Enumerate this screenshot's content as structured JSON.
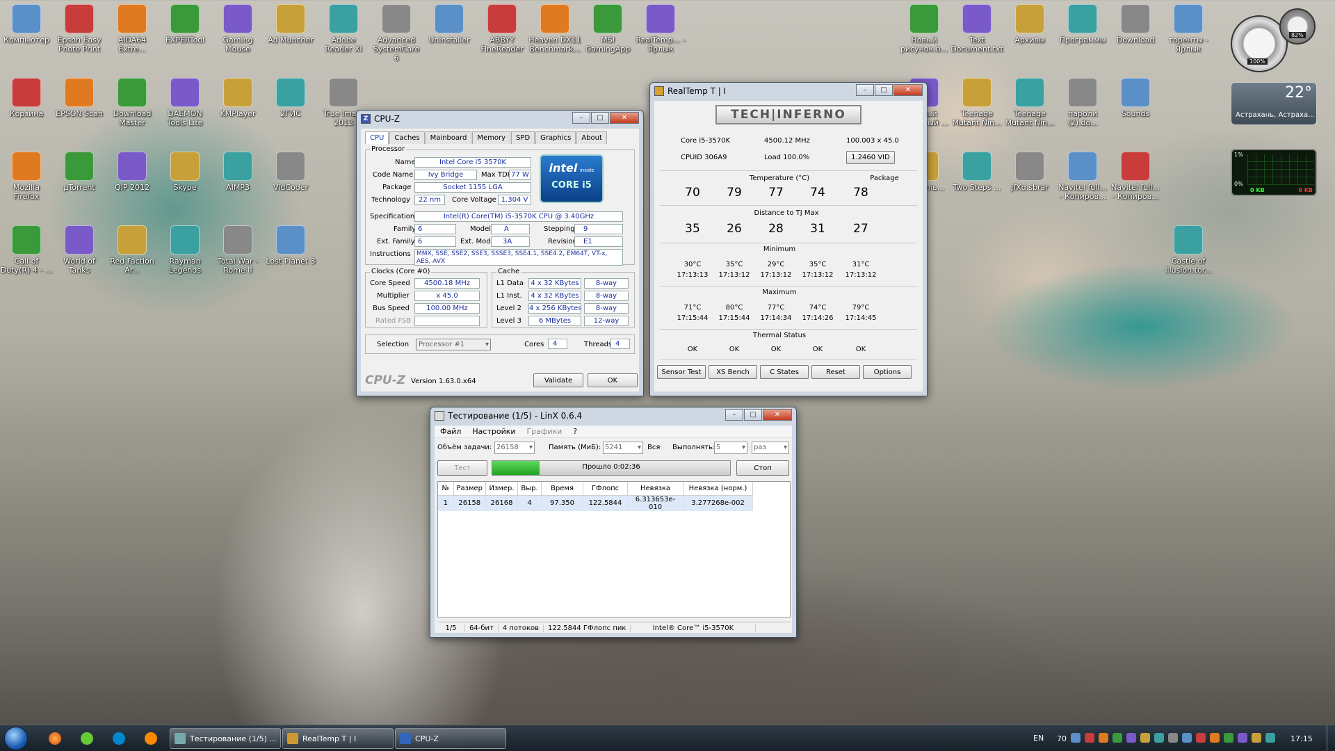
{
  "desktop_icons": {
    "c1": [
      "Компьютер",
      "Корзина",
      "Mozilla Firefox",
      "Call of Duty(R) 4 - ..."
    ],
    "c2": [
      "Epson Easy Photo Print",
      "EPSON Scan",
      "µTorrent",
      "World of Tanks"
    ],
    "c3": [
      "AIDA64 Extre...",
      "Download Master",
      "QIP 2012",
      "Red Faction Ar..."
    ],
    "c4": [
      "EXPERTool",
      "DAEMON Tools Lite",
      "Skype",
      "Rayman Legends"
    ],
    "c5": [
      "Gaming Mouse",
      "KMPlayer",
      "AIMP3",
      "Total War - Rome II"
    ],
    "c6": [
      "Ad Muncher",
      "2ГИС",
      "VidCoder",
      "Lost Planet 3"
    ],
    "c7": [
      "Adobe Reader XI",
      "True Ima... 2013"
    ],
    "c8": [
      "Advanced SystemCare 6"
    ],
    "c9": [
      "Uninstaller"
    ],
    "c10": [
      "ABBYY FineReader"
    ],
    "c11": [
      "Heaven DX11 Benchmark..."
    ],
    "c12": [
      "MSI GamingApp"
    ],
    "c13": [
      "RealTemp... - Ярлык"
    ],
    "r1": [
      "Новый рисунок.b...",
      "Text Document.txt",
      "Архивы",
      "Программы",
      "Download",
      "торенты - Ярлык"
    ],
    "r2": [
      "Новый точечный ...",
      "Teenage Mutant Nin...",
      "Teenage Mutant Nin...",
      "пароли (2).do...",
      "Sounds"
    ],
    "r3": [
      "Консоль...",
      "Two Steps ...",
      "jfXd.sbrar",
      "Navitel full... - Копиров...",
      "Navitel full... - Копиров..."
    ],
    "r4": [
      "Castle of Illusion.tor..."
    ]
  },
  "gadgets": {
    "weather_temp": "22°",
    "weather_city": "Астрахань, Астраха...",
    "cpu_pct": "100%",
    "ram_pct": "82%",
    "net_top": "1%",
    "net_zero": "0%",
    "net_in": "0 KB",
    "net_out": "0 KB"
  },
  "cpuz": {
    "title": "CPU-Z",
    "tabs": [
      "CPU",
      "Caches",
      "Mainboard",
      "Memory",
      "SPD",
      "Graphics",
      "About"
    ],
    "proc_group": "Processor",
    "l": {
      "name": "Name",
      "codename": "Code Name",
      "maxtdp": "Max TDP",
      "package": "Package",
      "tech": "Technology",
      "voltage": "Core Voltage",
      "spec": "Specification",
      "family": "Family",
      "model": "Model",
      "stepping": "Stepping",
      "extfamily": "Ext. Family",
      "extmodel": "Ext. Model",
      "revision": "Revision",
      "instr": "Instructions"
    },
    "v": {
      "name": "Intel Core i5 3570K",
      "codename": "Ivy Bridge",
      "maxtdp": "77 W",
      "package": "Socket 1155 LGA",
      "tech": "22 nm",
      "voltage": "1.304 V",
      "spec": "Intel(R) Core(TM) i5-3570K CPU @ 3.40GHz",
      "family": "6",
      "model": "A",
      "stepping": "9",
      "extfamily": "6",
      "extmodel": "3A",
      "revision": "E1",
      "instr": "MMX, SSE, SSE2, SSE3, SSSE3, SSE4.1, SSE4.2, EM64T, VT-x, AES, AVX"
    },
    "intel_badge": "intel",
    "intel_inside": "inside",
    "intel_core": "CORE i5",
    "clocks_group": "Clocks (Core #0)",
    "cl": {
      "speed": "Core Speed",
      "mult": "Multiplier",
      "bus": "Bus Speed",
      "fsb": "Rated FSB"
    },
    "cv": {
      "speed": "4500.18 MHz",
      "mult": "x 45.0",
      "bus": "100.00 MHz"
    },
    "cache_group": "Cache",
    "cache_rows": [
      {
        "l": "L1 Data",
        "s": "4 x 32 KBytes",
        "w": "8-way"
      },
      {
        "l": "L1 Inst.",
        "s": "4 x 32 KBytes",
        "w": "8-way"
      },
      {
        "l": "Level 2",
        "s": "4 x 256 KBytes",
        "w": "8-way"
      },
      {
        "l": "Level 3",
        "s": "6 MBytes",
        "w": "12-way"
      }
    ],
    "selection_label": "Selection",
    "selection": "Processor #1",
    "cores_label": "Cores",
    "cores": "4",
    "threads_label": "Threads",
    "threads": "4",
    "brand": "CPU-Z",
    "version": "Version 1.63.0.x64",
    "validate": "Validate",
    "ok": "OK"
  },
  "realtemp": {
    "title": "RealTemp T | I",
    "logo": "TECH|INFERNO",
    "cpu": "Core i5-3570K",
    "mhz": "4500.12 MHz",
    "mult": "100.003 x 45.0",
    "cpuid": "CPUID 306A9",
    "load": "Load 100.0%",
    "vid": "1.2460 VID",
    "temp_label": "Temperature (°C)",
    "package_label": "Package",
    "temps": [
      "70",
      "79",
      "77",
      "74"
    ],
    "package_temp": "78",
    "dist_label": "Distance to TJ Max",
    "dist": [
      "35",
      "26",
      "28",
      "31",
      "27"
    ],
    "min_label": "Minimum",
    "min": [
      {
        "t": "30°C",
        "h": "17:13:13"
      },
      {
        "t": "35°C",
        "h": "17:13:12"
      },
      {
        "t": "29°C",
        "h": "17:13:12"
      },
      {
        "t": "35°C",
        "h": "17:13:12"
      },
      {
        "t": "31°C",
        "h": "17:13:12"
      }
    ],
    "max_label": "Maximum",
    "max": [
      {
        "t": "71°C",
        "h": "17:15:44"
      },
      {
        "t": "80°C",
        "h": "17:15:44"
      },
      {
        "t": "77°C",
        "h": "17:14:34"
      },
      {
        "t": "74°C",
        "h": "17:14:26"
      },
      {
        "t": "79°C",
        "h": "17:14:45"
      }
    ],
    "status_label": "Thermal Status",
    "status": [
      "OK",
      "OK",
      "OK",
      "OK",
      "OK"
    ],
    "buttons": [
      "Sensor Test",
      "XS Bench",
      "C States",
      "Reset",
      "Options"
    ]
  },
  "linx": {
    "title": "Тестирование (1/5) - LinX 0.6.4",
    "menu": [
      "Файл",
      "Настройки",
      "Графики",
      "?"
    ],
    "size_label": "Объём задачи:",
    "size": "26158",
    "mem_label": "Память (МиБ):",
    "mem": "5241",
    "all": "Вся",
    "run_label": "Выполнять:",
    "runs": "5",
    "unit": "раз",
    "test_btn": "Тест",
    "progress_text": "Прошло 0:02:36",
    "progress": 0.2,
    "stop_btn": "Стоп",
    "headers": [
      "№",
      "Размер",
      "Измер.",
      "Выр.",
      "Время",
      "ГФлопс",
      "Невязка",
      "Невязка (норм.)"
    ],
    "rows": [
      [
        "1",
        "26158",
        "26168",
        "4",
        "97.350",
        "122.5844",
        "6.313653e-010",
        "3.277268e-002"
      ]
    ],
    "status": [
      "1/5",
      "64-бит",
      "4 потоков",
      "122.5844 ГФлопс пик",
      "Intel® Core™ i5-3570K"
    ]
  },
  "taskbar": {
    "tasks": [
      "Тестирование (1/5) ...",
      "RealTemp T | I",
      "CPU-Z"
    ],
    "lang": "EN",
    "temp": "70",
    "time": "17:15"
  }
}
